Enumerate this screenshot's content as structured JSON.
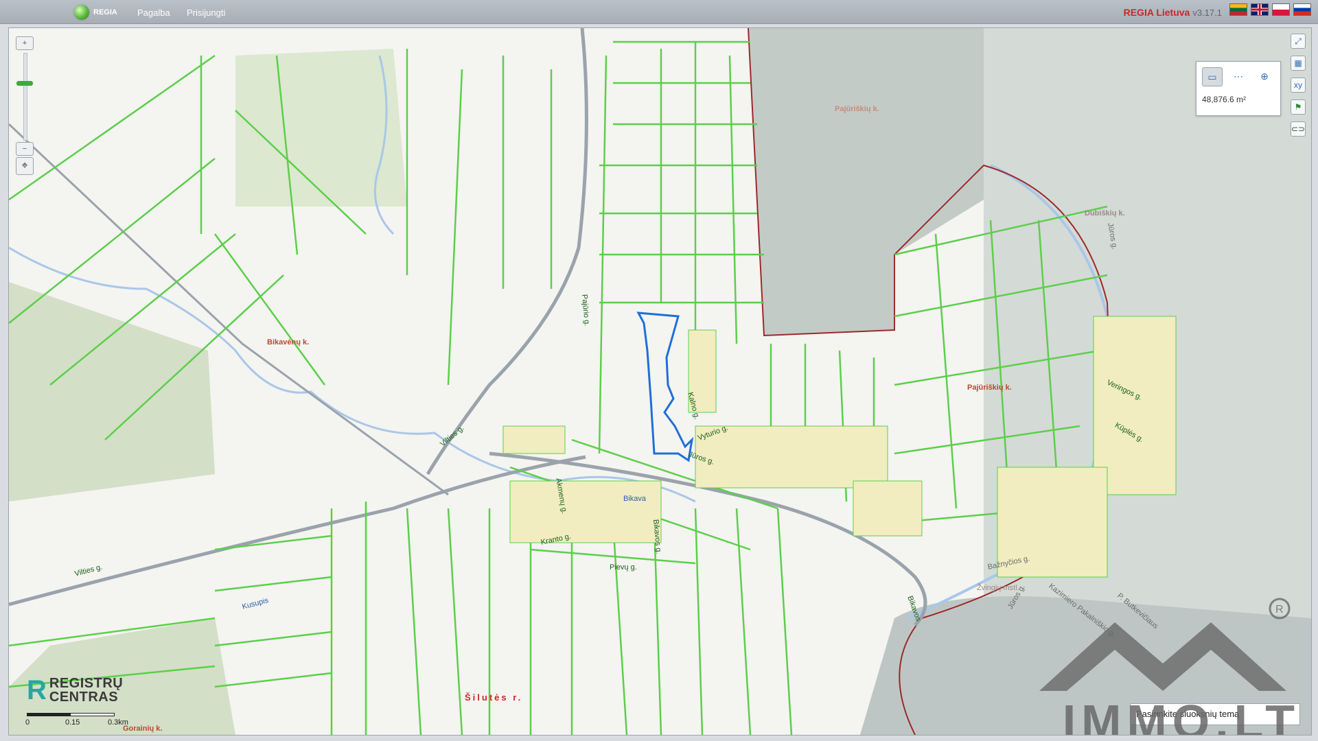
{
  "header": {
    "brand": "REGIA",
    "nav": [
      "Pagalba",
      "Prisijungti"
    ],
    "app_title": "REGIA Lietuva",
    "version": "v3.17.1",
    "languages": [
      "lt",
      "en",
      "pl",
      "ru"
    ]
  },
  "map_labels": {
    "places": [
      "Pajūriškių k.",
      "Dubiškių k.",
      "Bikavėnų k.",
      "Pajūriškių k.",
      "Šilutės r.",
      "Gorainių k.",
      "Žvingių mstl."
    ],
    "streets": [
      "Pajūrio g.",
      "Vilties g.",
      "Vilties g.",
      "Kalno g.",
      "Vyturio g.",
      "Jūros g.",
      "Akmenų g.",
      "Bikava",
      "Kranto g.",
      "Pievų g.",
      "Bikavos g.",
      "Kusupis",
      "Veringos g.",
      "Kūplės g.",
      "Bažnyčios g.",
      "Kazimiero Pakalniškio g.",
      "P. Butkevičiaus",
      "Jūros g.",
      "Jūros g.",
      "Bikavos"
    ]
  },
  "map": {
    "parcel_color": "#5ccf4a",
    "selection_color": "#1e6fd9",
    "boundary_color": "#9b2a2a",
    "forest_color": "#c8d8b8",
    "water_color": "#a9c7e8"
  },
  "measure": {
    "tools": [
      "measure-area-icon",
      "measure-distance-icon",
      "measure-point-icon"
    ],
    "value": "48,876.6 m²"
  },
  "controls": {
    "zoom_in": "+",
    "zoom_out": "−",
    "tools_right": [
      "fullscreen-icon",
      "measure-icon",
      "xy-icon",
      "flag-icon",
      "link-icon"
    ]
  },
  "footer": {
    "logo_line1": "REGISTRŲ",
    "logo_line2": "CENTRAS",
    "scale": [
      "0",
      "0.15",
      "0.3km"
    ],
    "layer_select": "Pasirinkite sluoksnių temą",
    "watermark": "IMMO.LT"
  }
}
